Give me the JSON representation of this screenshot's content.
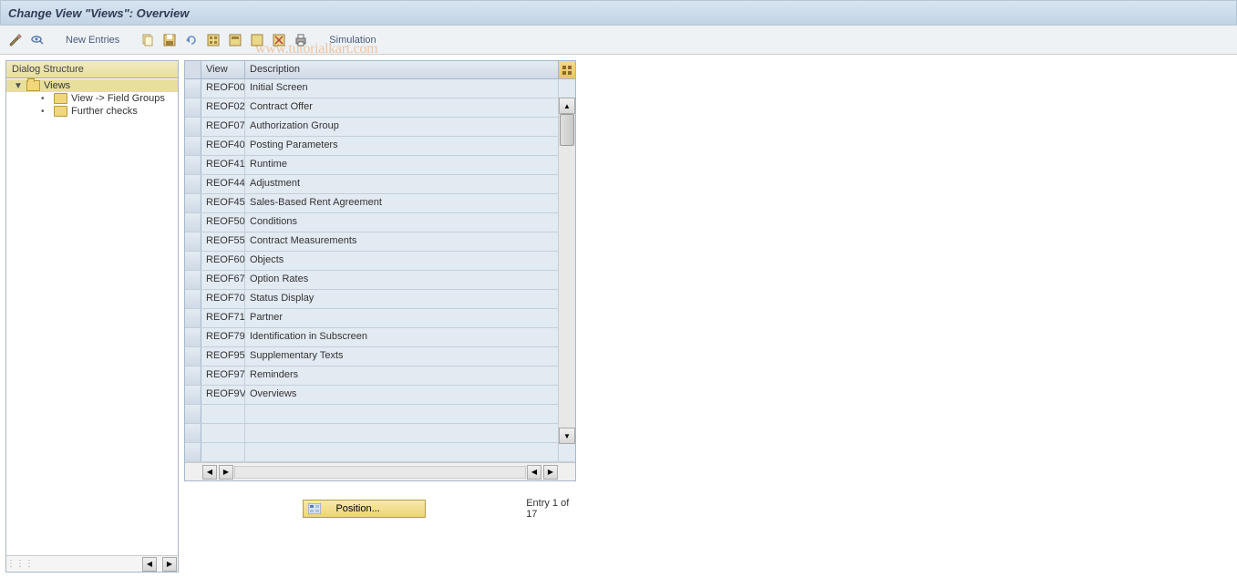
{
  "header": {
    "title": "Change View \"Views\": Overview"
  },
  "toolbar": {
    "new_entries": "New Entries",
    "simulation": "Simulation"
  },
  "sidebar": {
    "title": "Dialog Structure",
    "node_root": "Views",
    "node_field_groups": "View -> Field Groups",
    "node_further_checks": "Further checks"
  },
  "table": {
    "col_view": "View",
    "col_desc": "Description",
    "rows": [
      {
        "view": "REOF00",
        "desc": "Initial Screen"
      },
      {
        "view": "REOF02",
        "desc": "Contract Offer"
      },
      {
        "view": "REOF07",
        "desc": "Authorization Group"
      },
      {
        "view": "REOF40",
        "desc": "Posting Parameters"
      },
      {
        "view": "REOF41",
        "desc": "Runtime"
      },
      {
        "view": "REOF44",
        "desc": "Adjustment"
      },
      {
        "view": "REOF45",
        "desc": "Sales-Based Rent Agreement"
      },
      {
        "view": "REOF50",
        "desc": "Conditions"
      },
      {
        "view": "REOF55",
        "desc": "Contract Measurements"
      },
      {
        "view": "REOF60",
        "desc": "Objects"
      },
      {
        "view": "REOF67",
        "desc": "Option Rates"
      },
      {
        "view": "REOF70",
        "desc": "Status Display"
      },
      {
        "view": "REOF71",
        "desc": "Partner"
      },
      {
        "view": "REOF79",
        "desc": "Identification in Subscreen"
      },
      {
        "view": "REOF95",
        "desc": "Supplementary Texts"
      },
      {
        "view": "REOF97",
        "desc": "Reminders"
      },
      {
        "view": "REOF9V",
        "desc": "Overviews"
      }
    ]
  },
  "footer": {
    "position_label": "Position...",
    "entry_status": "Entry 1 of 17"
  },
  "watermark": "www.tutorialkart.com"
}
